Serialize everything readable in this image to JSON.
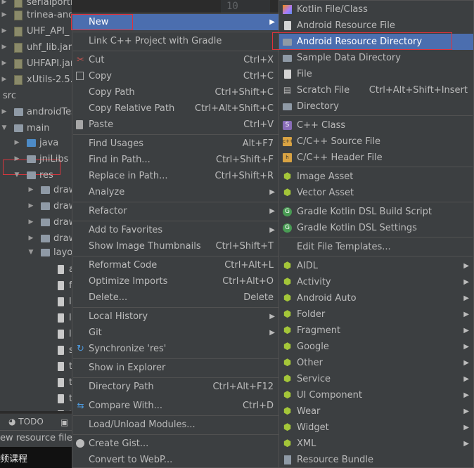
{
  "editor": {
    "line_number": "10"
  },
  "tree": {
    "items": [
      {
        "label": "serialportmodule.jar",
        "kind": "jar"
      },
      {
        "label": "trinea-android-common.jar",
        "kind": "jar"
      },
      {
        "label": "UHF_API_",
        "kind": "jar"
      },
      {
        "label": "uhf_lib.jar",
        "kind": "jar"
      },
      {
        "label": "UHFAPI.jar",
        "kind": "jar"
      },
      {
        "label": "xUtils-2.5.",
        "kind": "jar"
      },
      {
        "label": "src",
        "kind": "folder"
      },
      {
        "label": "androidTes",
        "kind": "folder"
      },
      {
        "label": "main",
        "kind": "folder"
      },
      {
        "label": "java",
        "kind": "folder-blue"
      },
      {
        "label": "jniLibs",
        "kind": "folder"
      },
      {
        "label": "res",
        "kind": "folder-res"
      },
      {
        "label": "draw",
        "kind": "folder"
      },
      {
        "label": "draw",
        "kind": "folder"
      },
      {
        "label": "draw",
        "kind": "folder"
      },
      {
        "label": "draw",
        "kind": "folder"
      },
      {
        "label": "layo",
        "kind": "folder"
      },
      {
        "label": "a",
        "kind": "xml"
      },
      {
        "label": "f",
        "kind": "xml"
      },
      {
        "label": "l",
        "kind": "xml"
      },
      {
        "label": "l",
        "kind": "xml"
      },
      {
        "label": "l",
        "kind": "xml"
      },
      {
        "label": "s",
        "kind": "xml"
      },
      {
        "label": "t",
        "kind": "xml"
      },
      {
        "label": "t",
        "kind": "xml"
      },
      {
        "label": "t",
        "kind": "xml"
      },
      {
        "label": "t",
        "kind": "xml"
      }
    ]
  },
  "tool_window_bar": {
    "todo_label": "TODO",
    "terminal_icon": "terminal-icon"
  },
  "status_bar": {
    "text": "ew resource file"
  },
  "taskbar": {
    "text": "频课程"
  },
  "context_menu": {
    "items": [
      {
        "label": "New",
        "shortcut": "",
        "submenu": true,
        "icon": ""
      },
      {
        "label": "Link C++ Project with Gradle",
        "shortcut": "",
        "submenu": false,
        "icon": ""
      },
      {
        "label": "Cut",
        "shortcut": "Ctrl+X",
        "submenu": false,
        "icon": "scissors-icon"
      },
      {
        "label": "Copy",
        "shortcut": "Ctrl+C",
        "submenu": false,
        "icon": "copy-icon"
      },
      {
        "label": "Copy Path",
        "shortcut": "Ctrl+Shift+C",
        "submenu": false,
        "icon": ""
      },
      {
        "label": "Copy Relative Path",
        "shortcut": "Ctrl+Alt+Shift+C",
        "submenu": false,
        "icon": ""
      },
      {
        "label": "Paste",
        "shortcut": "Ctrl+V",
        "submenu": false,
        "icon": "paste-icon"
      },
      {
        "label": "Find Usages",
        "shortcut": "Alt+F7",
        "submenu": false,
        "icon": ""
      },
      {
        "label": "Find in Path...",
        "shortcut": "Ctrl+Shift+F",
        "submenu": false,
        "icon": ""
      },
      {
        "label": "Replace in Path...",
        "shortcut": "Ctrl+Shift+R",
        "submenu": false,
        "icon": ""
      },
      {
        "label": "Analyze",
        "shortcut": "",
        "submenu": true,
        "icon": ""
      },
      {
        "label": "Refactor",
        "shortcut": "",
        "submenu": true,
        "icon": ""
      },
      {
        "label": "Add to Favorites",
        "shortcut": "",
        "submenu": true,
        "icon": ""
      },
      {
        "label": "Show Image Thumbnails",
        "shortcut": "Ctrl+Shift+T",
        "submenu": false,
        "icon": ""
      },
      {
        "label": "Reformat Code",
        "shortcut": "Ctrl+Alt+L",
        "submenu": false,
        "icon": ""
      },
      {
        "label": "Optimize Imports",
        "shortcut": "Ctrl+Alt+O",
        "submenu": false,
        "icon": ""
      },
      {
        "label": "Delete...",
        "shortcut": "Delete",
        "submenu": false,
        "icon": ""
      },
      {
        "label": "Local History",
        "shortcut": "",
        "submenu": true,
        "icon": ""
      },
      {
        "label": "Git",
        "shortcut": "",
        "submenu": true,
        "icon": ""
      },
      {
        "label": "Synchronize 'res'",
        "shortcut": "",
        "submenu": false,
        "icon": "sync-icon"
      },
      {
        "label": "Show in Explorer",
        "shortcut": "",
        "submenu": false,
        "icon": ""
      },
      {
        "label": "Directory Path",
        "shortcut": "Ctrl+Alt+F12",
        "submenu": false,
        "icon": ""
      },
      {
        "label": "Compare With...",
        "shortcut": "Ctrl+D",
        "submenu": false,
        "icon": "compare-icon"
      },
      {
        "label": "Load/Unload Modules...",
        "shortcut": "",
        "submenu": false,
        "icon": ""
      },
      {
        "label": "Create Gist...",
        "shortcut": "",
        "submenu": false,
        "icon": "github-icon"
      },
      {
        "label": "Convert to WebP...",
        "shortcut": "",
        "submenu": false,
        "icon": ""
      }
    ]
  },
  "submenu": {
    "items": [
      {
        "label": "Kotlin File/Class",
        "shortcut": "",
        "submenu": false,
        "icon": "kotlin-icon"
      },
      {
        "label": "Android Resource File",
        "shortcut": "",
        "submenu": false,
        "icon": "android-file-icon"
      },
      {
        "label": "Android Resource Directory",
        "shortcut": "",
        "submenu": false,
        "icon": "folder-icon"
      },
      {
        "label": "Sample Data Directory",
        "shortcut": "",
        "submenu": false,
        "icon": "folder-icon"
      },
      {
        "label": "File",
        "shortcut": "",
        "submenu": false,
        "icon": "file-icon"
      },
      {
        "label": "Scratch File",
        "shortcut": "Ctrl+Alt+Shift+Insert",
        "submenu": false,
        "icon": "scratch-icon"
      },
      {
        "label": "Directory",
        "shortcut": "",
        "submenu": false,
        "icon": "folder-icon"
      },
      {
        "label": "C++ Class",
        "shortcut": "",
        "submenu": false,
        "icon": "cpp-class-icon"
      },
      {
        "label": "C/C++ Source File",
        "shortcut": "",
        "submenu": false,
        "icon": "cpp-source-icon"
      },
      {
        "label": "C/C++ Header File",
        "shortcut": "",
        "submenu": false,
        "icon": "cpp-header-icon"
      },
      {
        "label": "Image Asset",
        "shortcut": "",
        "submenu": false,
        "icon": "android-icon"
      },
      {
        "label": "Vector Asset",
        "shortcut": "",
        "submenu": false,
        "icon": "android-icon"
      },
      {
        "label": "Gradle Kotlin DSL Build Script",
        "shortcut": "",
        "submenu": false,
        "icon": "gradle-icon"
      },
      {
        "label": "Gradle Kotlin DSL Settings",
        "shortcut": "",
        "submenu": false,
        "icon": "gradle-icon"
      },
      {
        "label": "Edit File Templates...",
        "shortcut": "",
        "submenu": false,
        "icon": ""
      },
      {
        "label": "AIDL",
        "shortcut": "",
        "submenu": true,
        "icon": "android-icon"
      },
      {
        "label": "Activity",
        "shortcut": "",
        "submenu": true,
        "icon": "android-icon"
      },
      {
        "label": "Android Auto",
        "shortcut": "",
        "submenu": true,
        "icon": "android-icon"
      },
      {
        "label": "Folder",
        "shortcut": "",
        "submenu": true,
        "icon": "android-icon"
      },
      {
        "label": "Fragment",
        "shortcut": "",
        "submenu": true,
        "icon": "android-icon"
      },
      {
        "label": "Google",
        "shortcut": "",
        "submenu": true,
        "icon": "android-icon"
      },
      {
        "label": "Other",
        "shortcut": "",
        "submenu": true,
        "icon": "android-icon"
      },
      {
        "label": "Service",
        "shortcut": "",
        "submenu": true,
        "icon": "android-icon"
      },
      {
        "label": "UI Component",
        "shortcut": "",
        "submenu": true,
        "icon": "android-icon"
      },
      {
        "label": "Wear",
        "shortcut": "",
        "submenu": true,
        "icon": "android-icon"
      },
      {
        "label": "Widget",
        "shortcut": "",
        "submenu": true,
        "icon": "android-icon"
      },
      {
        "label": "XML",
        "shortcut": "",
        "submenu": true,
        "icon": "android-icon"
      },
      {
        "label": "Resource Bundle",
        "shortcut": "",
        "submenu": false,
        "icon": "bundle-icon"
      }
    ]
  },
  "colors": {
    "selection": "#4b6eaf",
    "highlight_box": "#e0323a",
    "menu_bg": "#3c3f41"
  }
}
